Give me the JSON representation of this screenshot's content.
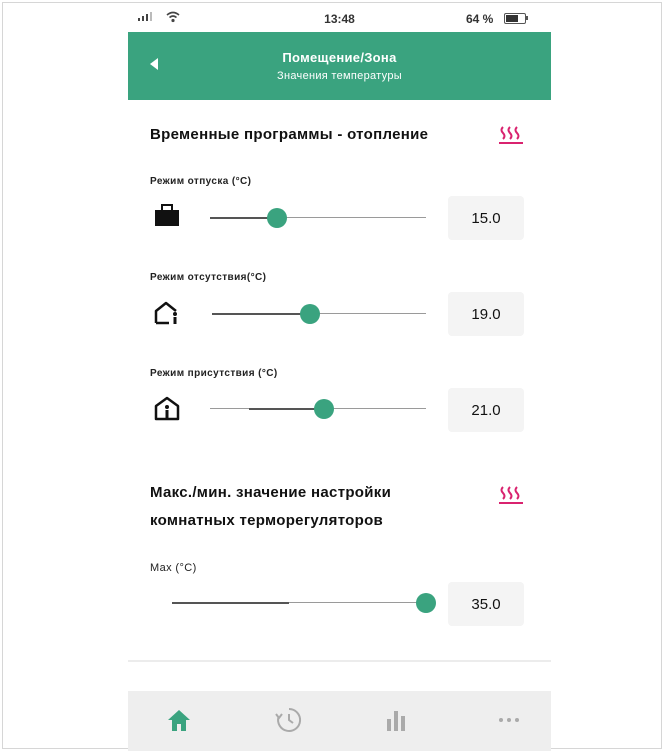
{
  "status_bar": {
    "time": "13:48",
    "battery": "64 %"
  },
  "header": {
    "title": "Помещение/Зона",
    "subtitle": "Значения температуры"
  },
  "section1": {
    "title": "Временные программы - отопление",
    "icon": "heating-icon",
    "items": [
      {
        "label": "Режим отпуска (°С)",
        "icon": "suitcase-icon",
        "value": "15.0",
        "fraction": 0.31
      },
      {
        "label": "Режим отсутствия(°С)",
        "icon": "house-person-away-icon",
        "value": "19.0",
        "fraction": 0.46
      },
      {
        "label": "Режим присутствия (°С)",
        "icon": "house-person-home-icon",
        "value": "21.0",
        "fraction": 0.53
      }
    ]
  },
  "section2": {
    "title_line1": "Макс./мин. значение настройки",
    "title_line2": "комнатных терморегуляторов",
    "icon": "heating-icon",
    "items": [
      {
        "label": "Max (°C)",
        "value": "35.0",
        "fraction": 1.0
      }
    ]
  },
  "tabbar": {
    "tabs": [
      "home-icon",
      "clock-icon",
      "statistics-icon",
      "more-icon"
    ],
    "active": "home-icon"
  },
  "colors": {
    "accent": "#3aa37f",
    "heat_icon": "#d9236f"
  }
}
